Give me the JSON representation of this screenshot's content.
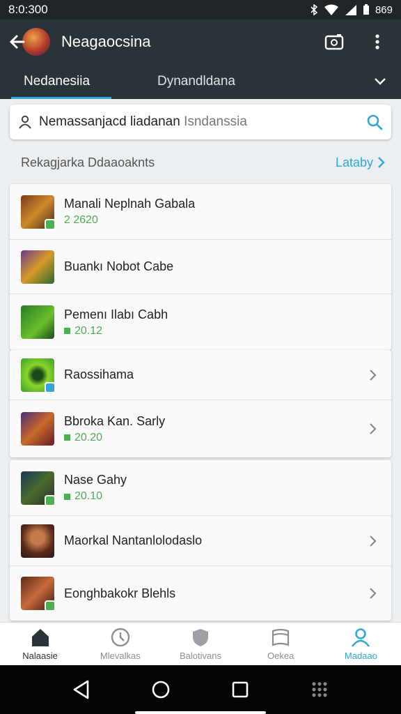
{
  "status": {
    "time": "8:0:300",
    "battery": "869"
  },
  "app_bar": {
    "title": "Neagaocsina"
  },
  "tabs": [
    {
      "label": "Nedanesiia"
    },
    {
      "label": "Dynandldana"
    }
  ],
  "search": {
    "value": "Nemassanjacd liadanan",
    "placeholder": "Isndanssia"
  },
  "section": {
    "title": "Rekagjarka Ddaaoaknts",
    "link": "Lataby"
  },
  "items": [
    {
      "title": "Manali Neplnah Gabala",
      "sub": "2 2620"
    },
    {
      "title": "Buankı Nobot Cabe",
      "sub": ""
    },
    {
      "title": "Pemenı Ilabı Cabh",
      "sub": "20.12"
    },
    {
      "title": "Raossihama",
      "sub": ""
    },
    {
      "title": "Bbroka Kan. Sarly",
      "sub": "20.20"
    },
    {
      "title": "Nase Gahy",
      "sub": "20.10"
    },
    {
      "title": "Maorkal Nantanlolodaslo",
      "sub": ""
    },
    {
      "title": "Eonghbakokr Blehls",
      "sub": ""
    }
  ],
  "bottom_nav": [
    {
      "label": "Nalaasie",
      "icon": "home-icon"
    },
    {
      "label": "Mlevalkas",
      "icon": "clock-icon"
    },
    {
      "label": "Balotivans",
      "icon": "shield-icon"
    },
    {
      "label": "Oekea",
      "icon": "book-icon"
    },
    {
      "label": "Madaao",
      "icon": "person-icon"
    }
  ],
  "colors": {
    "accent": "#2fa8d8",
    "green": "#4caf50",
    "appbar": "#2a3338"
  }
}
